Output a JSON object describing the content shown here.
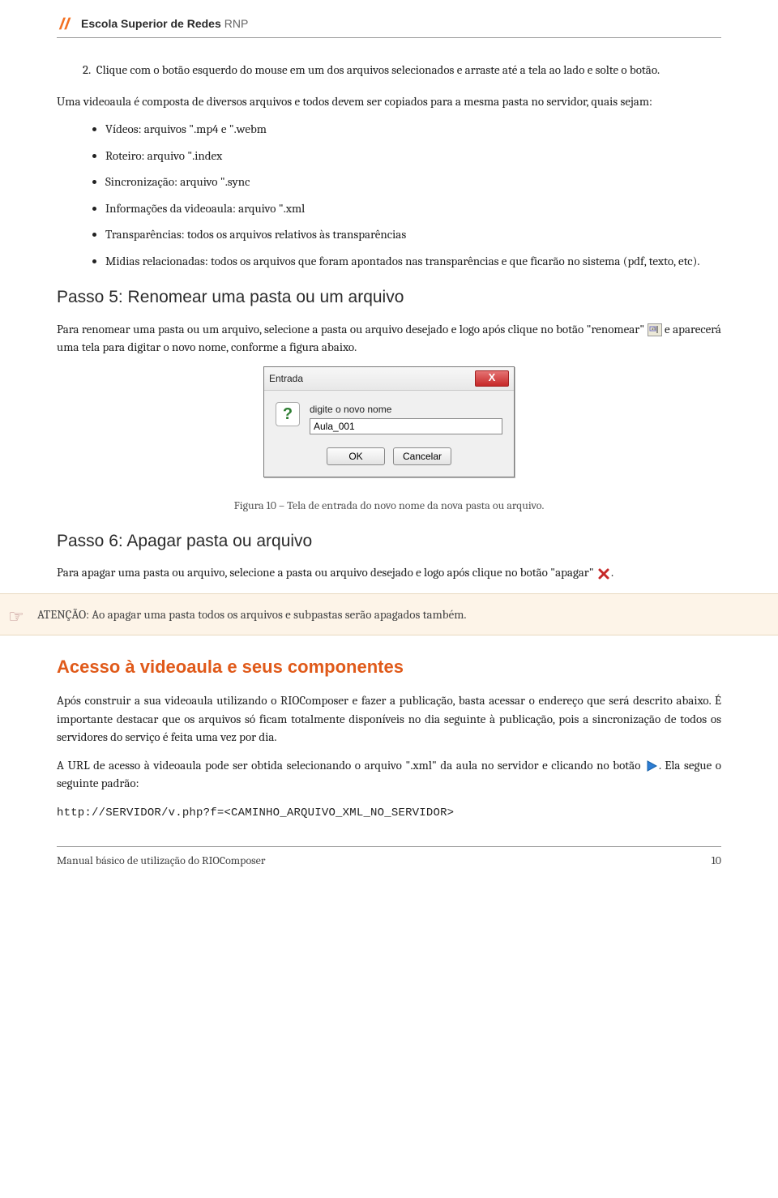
{
  "header": {
    "brand": "Escola Superior de Redes",
    "brand_suffix": "RNP"
  },
  "item2_num": "2.",
  "item2_text": "Clique com o botão esquerdo do mouse em um dos arquivos selecionados e arraste até a tela ao lado e solte o botão.",
  "intro2": "Uma videoaula é composta de diversos arquivos e todos devem ser copiados para a mesma pasta no servidor, quais sejam:",
  "bullets": [
    "Vídeos: arquivos \".mp4 e \".webm",
    "Roteiro: arquivo \".index",
    "Sincronização: arquivo \".sync",
    "Informações da videoaula: arquivo \".xml",
    "Transparências: todos os arquivos relativos às transparências",
    "Midias relacionadas: todos os arquivos que foram apontados nas transparências e que ficarão no sistema (pdf, texto, etc)."
  ],
  "step5_title": "Passo 5: Renomear uma pasta ou um arquivo",
  "step5_p1a": "Para renomear uma pasta ou um arquivo, selecione a pasta ou arquivo desejado e logo após clique no botão \"renomear\" ",
  "step5_p1b": " e aparecerá uma tela para digitar o novo nome, conforme a figura abaixo.",
  "dialog": {
    "title": "Entrada",
    "label": "digite o novo nome",
    "value": "Aula_001",
    "ok": "OK",
    "cancel": "Cancelar"
  },
  "figure10": "Figura 10 – Tela de entrada do novo nome da nova pasta ou arquivo.",
  "step6_title": "Passo 6: Apagar pasta ou arquivo",
  "step6_p1a": "Para apagar uma pasta ou arquivo, selecione a pasta ou arquivo desejado e logo após clique no botão \"apagar\" ",
  "step6_p1b": ".",
  "callout": "ATENÇÃO: Ao apagar uma pasta todos os arquivos e subpastas serão apagados também.",
  "section_title": "Acesso à videoaula e seus componentes",
  "access_p1": "Após construir a sua videoaula utilizando o RIOComposer e fazer a publicação, basta acessar o endereço que será descrito abaixo. É importante destacar que os arquivos só ficam totalmente disponíveis no dia seguinte à publicação, pois a sincronização de todos os servidores do serviço é feita uma vez por dia.",
  "access_p2a": "A URL de acesso à videoaula pode ser obtida selecionando o arquivo \".xml\" da aula no servidor e clicando no botão ",
  "access_p2b": ". Ela segue o seguinte padrão:",
  "url_pattern": "http://SERVIDOR/v.php?f=<CAMINHO_ARQUIVO_XML_NO_SERVIDOR>",
  "footer": {
    "left": "Manual básico de utilização do RIOComposer",
    "right": "10"
  }
}
